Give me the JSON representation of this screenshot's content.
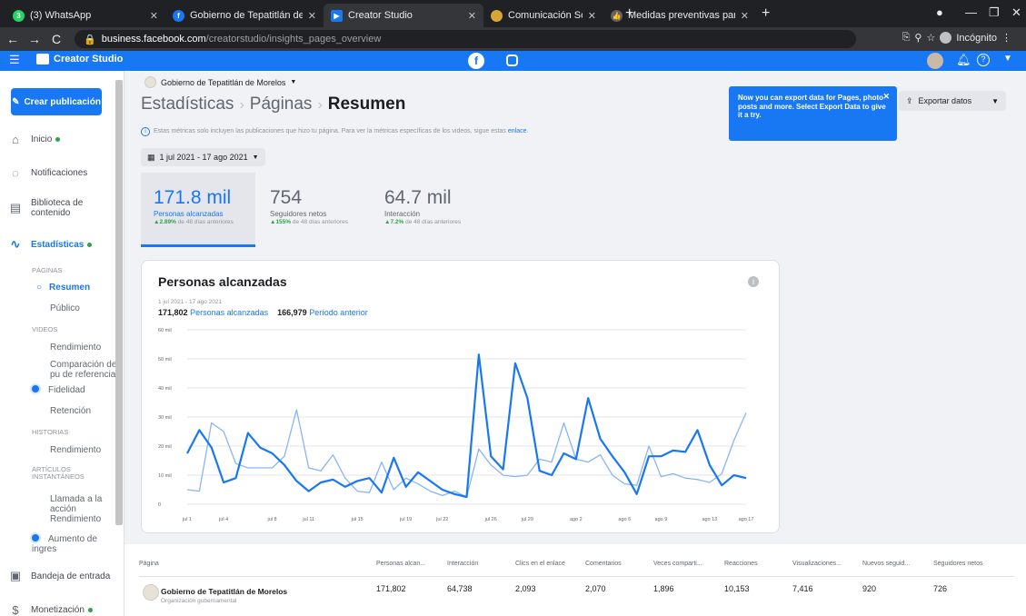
{
  "browser": {
    "tabs": [
      {
        "label": "(3) WhatsApp",
        "icon": "whatsapp-icon",
        "color": "#25d366",
        "badge": "3"
      },
      {
        "label": "Gobierno de Tepatitlán de Morel",
        "icon": "facebook-icon",
        "color": "#1877f2"
      },
      {
        "label": "Creator Studio",
        "icon": "creator-studio-icon",
        "color": "#1877f2"
      },
      {
        "label": "Comunicación Social | Gobierno",
        "icon": "emblem-icon",
        "color": "#d6a536"
      },
      {
        "label": "Medidas preventivas para evitar",
        "icon": "thumbs-up-icon",
        "color": "#5f6368"
      }
    ],
    "url_domain": "business.facebook.com",
    "url_path": "/creatorstudio/insights_pages_overview",
    "incognito_label": "Incógnito"
  },
  "app": {
    "brand": "Creator Studio",
    "accent": "#1877f2"
  },
  "sidebar": {
    "create_label": "Crear publicación",
    "inicio": "Inicio",
    "notificaciones": "Notificaciones",
    "biblioteca": "Biblioteca de contenido",
    "estadisticas": "Estadísticas",
    "sec_paginas": "PÁGINAS",
    "resumen": "Resumen",
    "publico": "Público",
    "sec_videos": "VIDEOS",
    "rendimiento": "Rendimiento",
    "comparacion": "Comparación de pu de referencia",
    "fidelidad": "Fidelidad",
    "retencion": "Retención",
    "sec_historias": "HISTORIAS",
    "rendimiento2": "Rendimiento",
    "sec_articulos": "ARTÍCULOS INSTANTÁNEOS",
    "llamada": "Llamada a la acción",
    "rendimiento3": "Rendimiento",
    "aumento": "Aumento de ingres",
    "bandeja": "Bandeja de entrada",
    "monetizacion": "Monetización"
  },
  "header": {
    "page_name": "Gobierno de Tepatitlán de Morelos",
    "crumb1": "Estadísticas",
    "crumb2": "Páginas",
    "crumb3": "Resumen",
    "note": "Estas métricas solo incluyen las publicaciones que hizo tu página. Para ver la métricas específicas de los videos, sigue estas",
    "note_link": "enlace",
    "date_range": "1 jul 2021 - 17 ago 2021",
    "tooltip": "Now you can export data for Pages, photo posts and more. Select Export Data to give it a try.",
    "export_label": "Exportar datos"
  },
  "metrics": [
    {
      "value": "171.8 mil",
      "label": "Personas alcanzadas",
      "change": "2.89%",
      "suffix": "de 48 días anteriores"
    },
    {
      "value": "754",
      "label": "Seguidores netos",
      "change": "155%",
      "suffix": "de 48 días anteriores"
    },
    {
      "value": "64.7 mil",
      "label": "Interacción",
      "change": "7.2%",
      "suffix": "de 48 días anteriores"
    }
  ],
  "card": {
    "title": "Personas alcanzadas",
    "range": "1 jul 2021 - 17 ago 2021",
    "current_value": "171,802",
    "current_label": "Personas alcanzadas",
    "previous_value": "166,979",
    "previous_label": "Período anterior"
  },
  "chart_data": {
    "type": "line",
    "title": "Personas alcanzadas",
    "ylim": [
      0,
      60
    ],
    "y_ticks": [
      "0",
      "10 mil",
      "20 mil",
      "30 mil",
      "40 mil",
      "50 mil",
      "60 mil"
    ],
    "x_ticks": [
      "jul 1",
      "jul 4",
      "jul 8",
      "jul 11",
      "jul 15",
      "jul 19",
      "jul 22",
      "jul 26",
      "jul 29",
      "ago 2",
      "ago 6",
      "ago 9",
      "ago 13",
      "ago 17"
    ],
    "grid": true,
    "series": [
      {
        "name": "Personas alcanzadas",
        "color": "#1877f2",
        "values": [
          17.5,
          25.5,
          19.5,
          7.5,
          9.0,
          24.5,
          19.5,
          17.5,
          13.5,
          8.0,
          4.5,
          7.5,
          8.5,
          6.0,
          8.0,
          9.0,
          4.0,
          16.0,
          6.0,
          11.0,
          8.0,
          5.0,
          3.5,
          2.5,
          51.5,
          16.5,
          12.0,
          48.5,
          36.5,
          11.5,
          10.0,
          17.5,
          15.5,
          36.5,
          22.5,
          16.5,
          11.0,
          3.5,
          16.5,
          16.5,
          18.5,
          18.0,
          25.5,
          13.5,
          6.5,
          10.0,
          9.0
        ]
      },
      {
        "name": "Período anterior",
        "color": "#8ab4f8",
        "values": [
          5.0,
          4.5,
          28.0,
          25.0,
          14.0,
          12.5,
          12.5,
          12.5,
          16.5,
          32.5,
          12.5,
          11.5,
          17.0,
          9.0,
          4.5,
          4.0,
          14.5,
          5.0,
          9.0,
          7.0,
          4.5,
          3.0,
          4.5,
          2.5,
          19.0,
          13.5,
          10.0,
          9.5,
          10.0,
          15.5,
          14.5,
          28.0,
          15.5,
          14.5,
          17.0,
          10.0,
          7.0,
          6.5,
          20.0,
          9.5,
          10.5,
          9.0,
          8.5,
          7.5,
          10.5,
          22.0,
          31.5
        ]
      }
    ]
  },
  "table": {
    "headers": [
      "Página",
      "Personas alcan...",
      "Interacción",
      "Clics en el enlace",
      "Comentarios",
      "Veces comparti...",
      "Reacciones",
      "Visualizaciones...",
      "Nuevos seguid...",
      "Seguidores netos"
    ],
    "page_name": "Gobierno de Tepatitlán de Morelos",
    "page_type": "Organización gubernamental",
    "values": [
      "171,802",
      "64,738",
      "2,093",
      "2,070",
      "1,896",
      "10,153",
      "7,416",
      "920",
      "726"
    ]
  }
}
